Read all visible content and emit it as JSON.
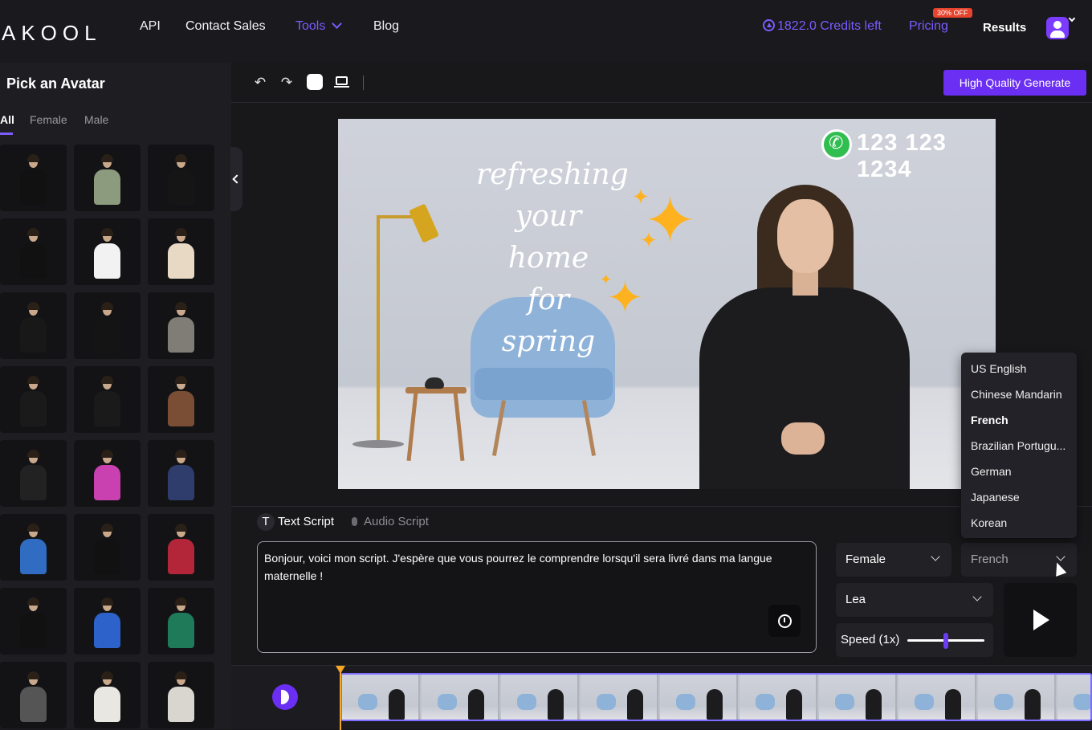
{
  "nav": {
    "logo": "AKOOL",
    "links": [
      "API",
      "Contact Sales",
      "Tools",
      "Blog"
    ],
    "credits": "1822.0 Credits left",
    "pricing": "Pricing",
    "discount_badge": "30% OFF",
    "results": "Results"
  },
  "left_panel": {
    "title": "Pick an Avatar",
    "tabs": [
      "All",
      "Female",
      "Male"
    ],
    "active_tab": "All"
  },
  "toolbar": {
    "generate_label": "High Quality Generate"
  },
  "canvas": {
    "slogan_lines": [
      "refreshing",
      "your home",
      "for spring"
    ],
    "phone": "123 123 1234"
  },
  "script": {
    "tabs": [
      "Text Script",
      "Audio Script"
    ],
    "text": "Bonjour, voici mon script. J'espère que vous pourrez le comprendre lorsqu'il sera livré dans ma langue maternelle !"
  },
  "voice": {
    "gender": "Female",
    "language": "French",
    "voice_name": "Lea",
    "speed_label": "Speed (1x)",
    "speed_value": 0.5
  },
  "language_dropdown": {
    "options": [
      "US English",
      "Chinese Mandarin",
      "French",
      "Brazilian Portugu...",
      "German",
      "Japanese",
      "Korean"
    ],
    "selected": "French"
  },
  "timeline": {
    "frames": 10
  },
  "colors": {
    "accent": "#6a2ff2",
    "accent_text": "#7c5cff",
    "playhead": "#f5a623",
    "badge": "#e6442d"
  }
}
